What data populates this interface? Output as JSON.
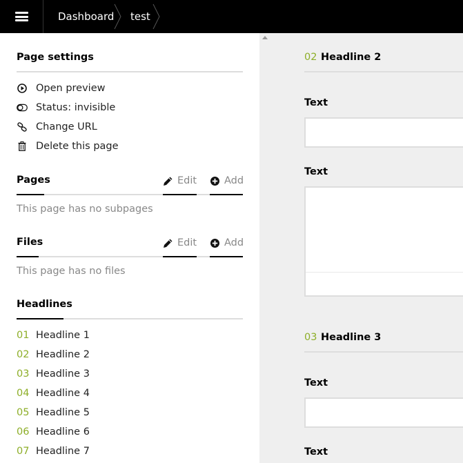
{
  "topbar": {
    "breadcrumbs": [
      "Dashboard",
      "test"
    ]
  },
  "sidebar": {
    "page_settings": {
      "title": "Page settings",
      "items": [
        {
          "label": "Open preview",
          "icon": "play-circle-icon"
        },
        {
          "label": "Status: invisible",
          "icon": "toggle-off-icon"
        },
        {
          "label": "Change URL",
          "icon": "chain-link-icon"
        },
        {
          "label": "Delete this page",
          "icon": "trash-icon"
        }
      ]
    },
    "pages": {
      "title": "Pages",
      "edit_label": "Edit",
      "add_label": "Add",
      "empty_text": "This page has no subpages"
    },
    "files": {
      "title": "Files",
      "edit_label": "Edit",
      "add_label": "Add",
      "empty_text": "This page has no files"
    },
    "headlines": {
      "title": "Headlines",
      "items": [
        {
          "num": "01",
          "label": "Headline 1"
        },
        {
          "num": "02",
          "label": "Headline 2"
        },
        {
          "num": "03",
          "label": "Headline 3"
        },
        {
          "num": "04",
          "label": "Headline 4"
        },
        {
          "num": "05",
          "label": "Headline 5"
        },
        {
          "num": "06",
          "label": "Headline 6"
        },
        {
          "num": "07",
          "label": "Headline 7"
        }
      ]
    }
  },
  "main": {
    "sections": [
      {
        "num": "02",
        "title": "Headline 2",
        "fields": [
          {
            "label": "Text",
            "type": "input",
            "value": ""
          },
          {
            "label": "Text",
            "type": "textarea",
            "value": ""
          }
        ]
      },
      {
        "num": "03",
        "title": "Headline 3",
        "fields": [
          {
            "label": "Text",
            "type": "input",
            "value": ""
          },
          {
            "label": "Text",
            "type": "textarea",
            "value": ""
          }
        ]
      }
    ]
  },
  "colors": {
    "topbar_bg": "#000000",
    "accent_green": "#8dae28",
    "main_bg": "#efefef",
    "muted_text": "#888888"
  }
}
